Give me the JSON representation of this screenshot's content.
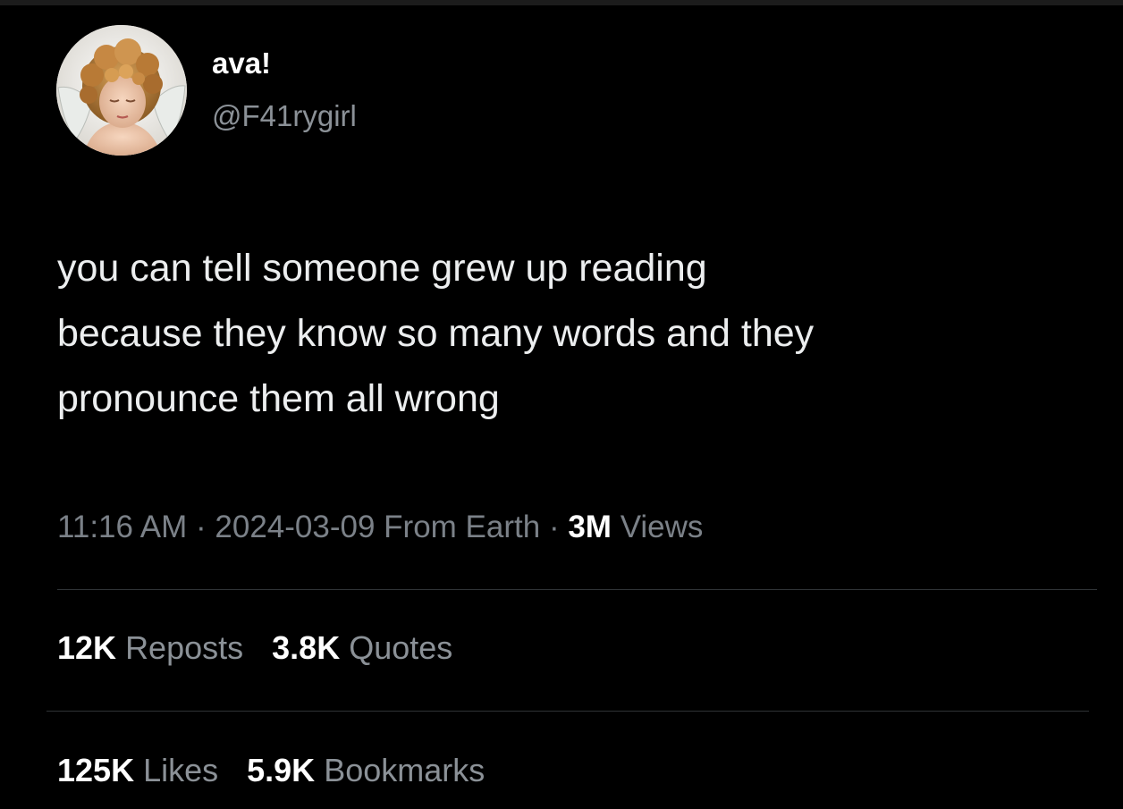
{
  "author": {
    "display_name": "ava!",
    "handle": "@F41rygirl",
    "avatar_icon": "cherub-angel-avatar"
  },
  "tweet": {
    "text_lines": [
      "you can tell someone grew up reading",
      "because they know so many words and they",
      "pronounce them all wrong"
    ]
  },
  "meta": {
    "time": "11:16 AM",
    "separator": "·",
    "date_source": "2024-03-09 From Earth",
    "views_count": "3M",
    "views_label": "Views"
  },
  "stats": {
    "reposts": {
      "count": "12K",
      "label": "Reposts"
    },
    "quotes": {
      "count": "3.8K",
      "label": "Quotes"
    },
    "likes": {
      "count": "125K",
      "label": "Likes"
    },
    "bookmarks": {
      "count": "5.9K",
      "label": "Bookmarks"
    }
  },
  "colors": {
    "background": "#000000",
    "text_primary": "#ffffff",
    "text_secondary": "#8b9197",
    "divider": "#2f3336"
  }
}
